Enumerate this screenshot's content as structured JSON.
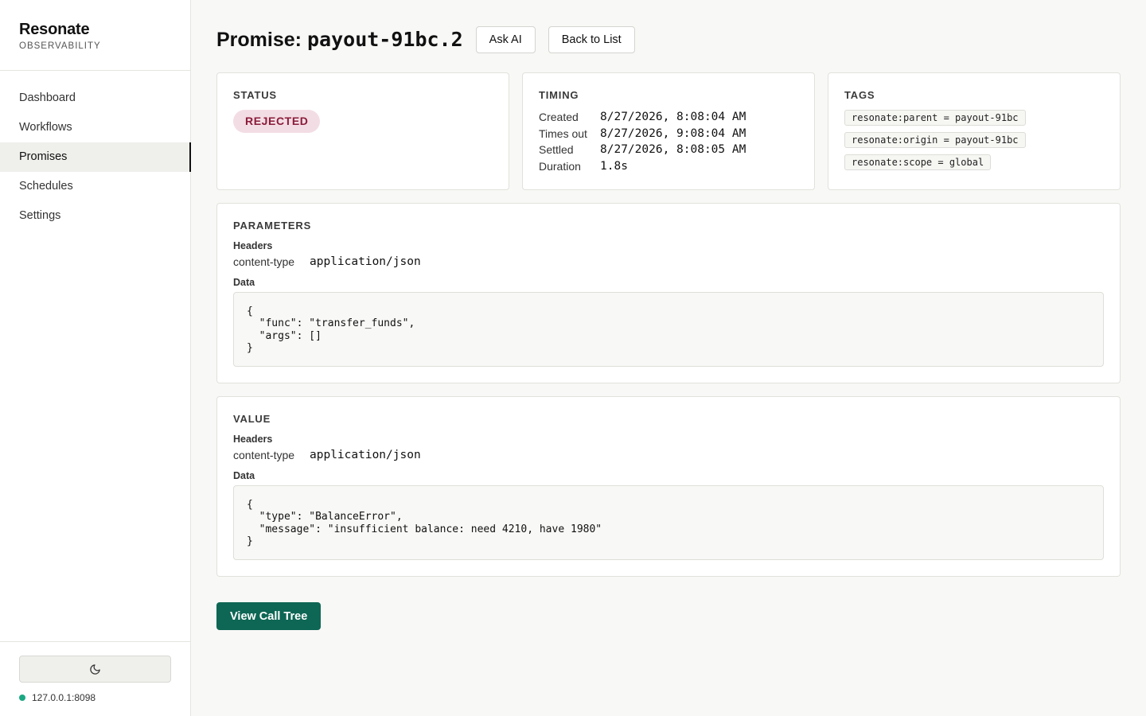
{
  "app": {
    "name": "Resonate",
    "subtitle": "OBSERVABILITY"
  },
  "nav": [
    {
      "label": "Dashboard"
    },
    {
      "label": "Workflows"
    },
    {
      "label": "Promises"
    },
    {
      "label": "Schedules"
    },
    {
      "label": "Settings"
    }
  ],
  "nav_active": "Promises",
  "footer": {
    "theme_icon": "moon-icon",
    "server": "127.0.0.1:8098",
    "status_color": "#1aa883"
  },
  "page": {
    "title_prefix": "Promise:",
    "promise_id": "payout-91bc.2",
    "ask_ai": "Ask AI",
    "back": "Back to List"
  },
  "status": {
    "heading": "STATUS",
    "value": "REJECTED"
  },
  "timing": {
    "heading": "TIMING",
    "rows": [
      {
        "label": "Created",
        "value": "8/27/2026, 8:08:04 AM"
      },
      {
        "label": "Times out",
        "value": "8/27/2026, 9:08:04 AM"
      },
      {
        "label": "Settled",
        "value": "8/27/2026, 8:08:05 AM"
      },
      {
        "label": "Duration",
        "value": "1.8s"
      }
    ]
  },
  "tags": {
    "heading": "TAGS",
    "items": [
      "resonate:parent = payout-91bc",
      "resonate:origin = payout-91bc",
      "resonate:scope = global"
    ]
  },
  "parameters": {
    "heading": "PARAMETERS",
    "headers_label": "Headers",
    "header_key": "content-type",
    "header_value": "application/json",
    "data_label": "Data",
    "data": "{\n  \"func\": \"transfer_funds\",\n  \"args\": []\n}"
  },
  "value": {
    "heading": "VALUE",
    "headers_label": "Headers",
    "header_key": "content-type",
    "header_value": "application/json",
    "data_label": "Data",
    "data": "{\n  \"type\": \"BalanceError\",\n  \"message\": \"insufficient balance: need 4210, have 1980\"\n}"
  },
  "actions": {
    "call_tree": "View Call Tree"
  }
}
